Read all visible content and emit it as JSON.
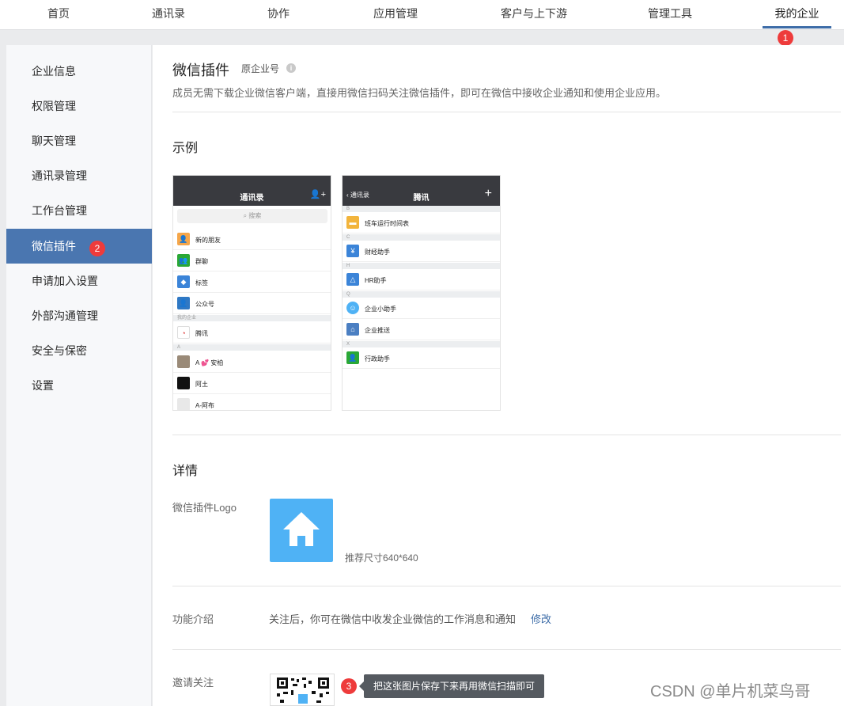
{
  "topnav": {
    "items": [
      "首页",
      "通讯录",
      "协作",
      "应用管理",
      "客户与上下游",
      "管理工具",
      "我的企业"
    ],
    "active_index": 6
  },
  "badges": {
    "nav": "1",
    "sidebar": "2",
    "invite": "3"
  },
  "sidebar": {
    "items": [
      "企业信息",
      "权限管理",
      "聊天管理",
      "通讯录管理",
      "工作台管理",
      "微信插件",
      "申请加入设置",
      "外部沟通管理",
      "安全与保密",
      "设置"
    ],
    "active_index": 5
  },
  "main": {
    "title": "微信插件",
    "subtitle": "原企业号",
    "info_icon": "i",
    "description": "成员无需下载企业微信客户端，直接用微信扫码关注微信插件，即可在微信中接收企业通知和使用企业应用。",
    "example_title": "示例",
    "details_title": "详情",
    "logo_label": "微信插件Logo",
    "logo_hint": "推荐尺寸640*640",
    "intro_label": "功能介绍",
    "intro_value": "关注后，你可在微信中收发企业微信的工作消息和通知",
    "intro_edit": "修改",
    "invite_label": "邀请关注",
    "invite_tooltip": "把这张图片保存下来再用微信扫描即可"
  },
  "phone1": {
    "title": "通讯录",
    "search": "搜索",
    "rows": [
      "新的朋友",
      "群聊",
      "标签",
      "公众号"
    ],
    "section_company": "我的企业",
    "company": "腾讯",
    "section_a": "A",
    "contacts": [
      "A 💕 安柏",
      "阿土",
      "A-阿布"
    ]
  },
  "phone2": {
    "back": "通讯录",
    "title": "腾讯",
    "sections": [
      "B",
      "C",
      "H",
      "Q",
      "X"
    ],
    "rows": [
      "班车运行时间表",
      "财经助手",
      "HR助手",
      "企业小助手",
      "企业推送",
      "行政助手"
    ]
  },
  "colors": {
    "accent": "#4a76b0",
    "badge": "#ee3b3b",
    "logo_bg": "#4fb2f5",
    "link": "#3e6da8"
  },
  "watermark": "CSDN @单片机菜鸟哥"
}
